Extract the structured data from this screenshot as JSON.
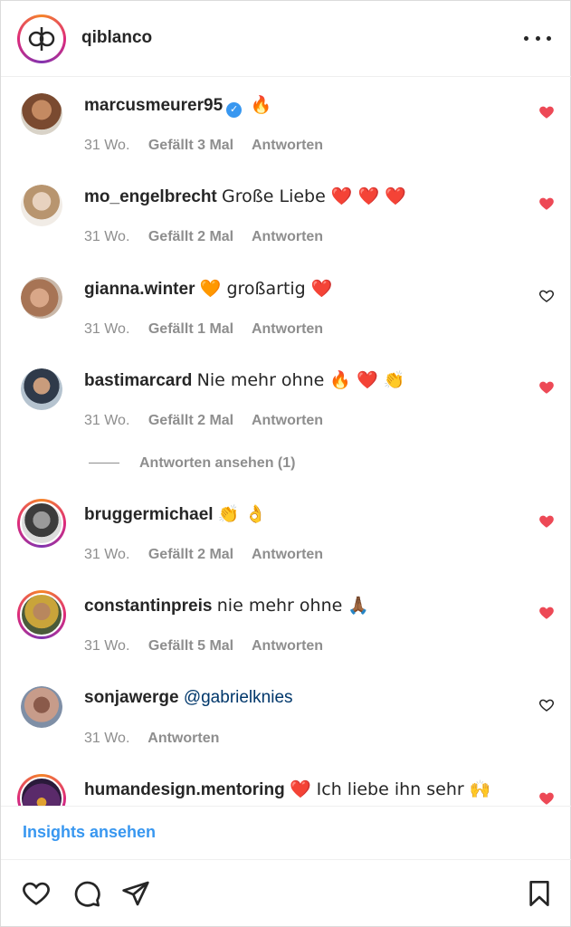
{
  "header": {
    "username": "qiblanco",
    "more_icon": "more-horizontal-icon"
  },
  "comments": [
    {
      "user": "marcusmeurer95",
      "verified": true,
      "text": "🔥",
      "time": "31 Wo.",
      "likes": "Gefällt 3 Mal",
      "reply": "Antworten",
      "liked": true
    },
    {
      "user": "mo_engelbrecht",
      "verified": false,
      "text": "Große Liebe ❤️ ❤️ ❤️",
      "time": "31 Wo.",
      "likes": "Gefällt 2 Mal",
      "reply": "Antworten",
      "liked": true
    },
    {
      "user": "gianna.winter",
      "verified": false,
      "text": "🧡 großartig ❤️",
      "time": "31 Wo.",
      "likes": "Gefällt 1 Mal",
      "reply": "Antworten",
      "liked": false
    },
    {
      "user": "bastimarcard",
      "verified": false,
      "text": "Nie mehr ohne 🔥 ❤️ 👏",
      "time": "31 Wo.",
      "likes": "Gefällt 2 Mal",
      "reply": "Antworten",
      "liked": true
    },
    {
      "user": "bruggermichael",
      "verified": false,
      "text": "👏 👌",
      "time": "31 Wo.",
      "likes": "Gefällt 2 Mal",
      "reply": "Antworten",
      "liked": true
    },
    {
      "user": "constantinpreis",
      "verified": false,
      "text": "nie mehr ohne 🙏🏾",
      "time": "31 Wo.",
      "likes": "Gefällt 5 Mal",
      "reply": "Antworten",
      "liked": true
    },
    {
      "user": "sonjawerge",
      "verified": false,
      "text": "@gabrielknies",
      "time": "31 Wo.",
      "likes": "",
      "reply": "Antworten",
      "liked": false
    },
    {
      "user": "humandesign.mentoring",
      "verified": false,
      "text": "❤️ Ich liebe ihn sehr 🙌",
      "time": "",
      "likes": "",
      "reply": "",
      "liked": true
    }
  ],
  "view_replies": "Antworten ansehen (1)",
  "insights_label": "Insights ansehen",
  "colors": {
    "like_red": "#ed4956",
    "link_blue": "#3897f0",
    "meta_gray": "#8e8e8e",
    "text": "#262626"
  },
  "actions": {
    "icons": [
      "heart-icon",
      "comment-icon",
      "share-icon",
      "bookmark-icon"
    ]
  }
}
